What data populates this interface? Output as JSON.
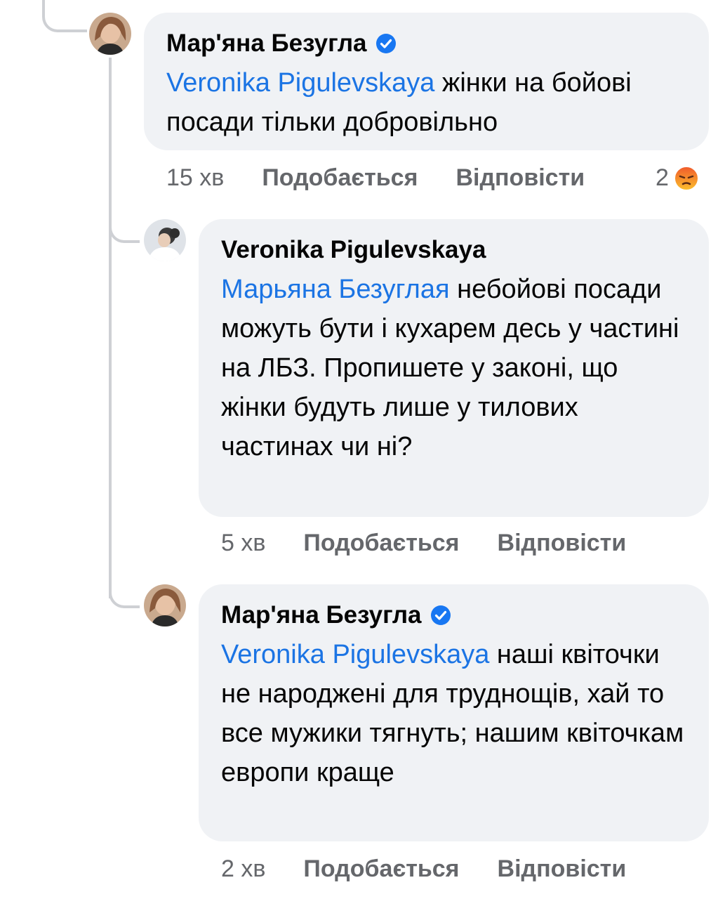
{
  "comments": [
    {
      "author": "Мар'яна Безугла",
      "verified": true,
      "mention": "Veronika  Pigulevskaya",
      "text": " жінки на бойові посади тільки добровільно",
      "time": "15 хв",
      "like_label": "Подобається",
      "reply_label": "Відповісти",
      "reaction_count": "2",
      "reaction_icon": "angry-reaction-icon"
    },
    {
      "author": "Veronika  Pigulevskaya",
      "verified": false,
      "mention": "Марьяна Безуглая",
      "text": " небойові посади можуть бути і кухарем десь у частині на ЛБЗ. Пропишете у законі, що жінки будуть лише у тилових частинах чи ні?",
      "time": "5 хв",
      "like_label": "Подобається",
      "reply_label": "Відповісти"
    },
    {
      "author": "Мар'яна Безугла",
      "verified": true,
      "mention": "Veronika  Pigulevskaya",
      "text": " наші квіточки не народжені для труднощів, хай то все мужики тягнуть; нашим квіточкам европи краще",
      "time": "2 хв",
      "like_label": "Подобається",
      "reply_label": "Відповісти"
    }
  ],
  "colors": {
    "mention": "#1b74e4",
    "bubble": "#f0f2f5",
    "meta": "#65676b",
    "verified": "#1877f2"
  }
}
